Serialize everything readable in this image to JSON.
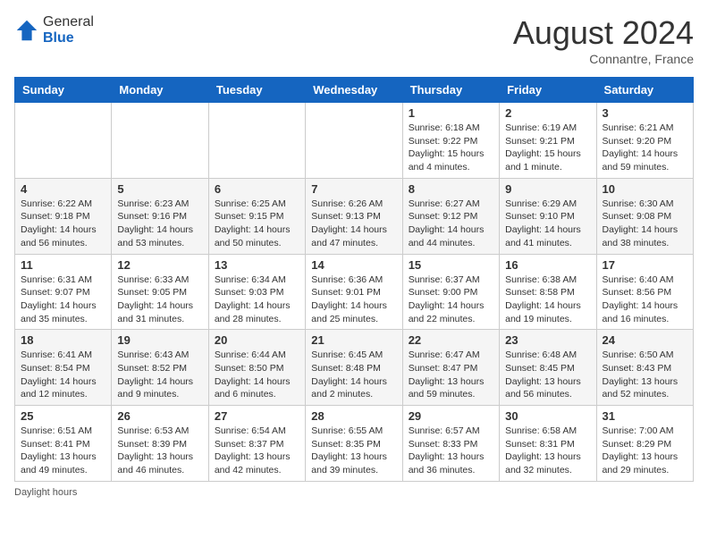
{
  "header": {
    "logo": {
      "line1": "General",
      "line2": "Blue"
    },
    "title": "August 2024",
    "location": "Connantre, France"
  },
  "days_of_week": [
    "Sunday",
    "Monday",
    "Tuesday",
    "Wednesday",
    "Thursday",
    "Friday",
    "Saturday"
  ],
  "weeks": [
    [
      {
        "day": "",
        "info": ""
      },
      {
        "day": "",
        "info": ""
      },
      {
        "day": "",
        "info": ""
      },
      {
        "day": "",
        "info": ""
      },
      {
        "day": "1",
        "info": "Sunrise: 6:18 AM\nSunset: 9:22 PM\nDaylight: 15 hours\nand 4 minutes."
      },
      {
        "day": "2",
        "info": "Sunrise: 6:19 AM\nSunset: 9:21 PM\nDaylight: 15 hours\nand 1 minute."
      },
      {
        "day": "3",
        "info": "Sunrise: 6:21 AM\nSunset: 9:20 PM\nDaylight: 14 hours\nand 59 minutes."
      }
    ],
    [
      {
        "day": "4",
        "info": "Sunrise: 6:22 AM\nSunset: 9:18 PM\nDaylight: 14 hours\nand 56 minutes."
      },
      {
        "day": "5",
        "info": "Sunrise: 6:23 AM\nSunset: 9:16 PM\nDaylight: 14 hours\nand 53 minutes."
      },
      {
        "day": "6",
        "info": "Sunrise: 6:25 AM\nSunset: 9:15 PM\nDaylight: 14 hours\nand 50 minutes."
      },
      {
        "day": "7",
        "info": "Sunrise: 6:26 AM\nSunset: 9:13 PM\nDaylight: 14 hours\nand 47 minutes."
      },
      {
        "day": "8",
        "info": "Sunrise: 6:27 AM\nSunset: 9:12 PM\nDaylight: 14 hours\nand 44 minutes."
      },
      {
        "day": "9",
        "info": "Sunrise: 6:29 AM\nSunset: 9:10 PM\nDaylight: 14 hours\nand 41 minutes."
      },
      {
        "day": "10",
        "info": "Sunrise: 6:30 AM\nSunset: 9:08 PM\nDaylight: 14 hours\nand 38 minutes."
      }
    ],
    [
      {
        "day": "11",
        "info": "Sunrise: 6:31 AM\nSunset: 9:07 PM\nDaylight: 14 hours\nand 35 minutes."
      },
      {
        "day": "12",
        "info": "Sunrise: 6:33 AM\nSunset: 9:05 PM\nDaylight: 14 hours\nand 31 minutes."
      },
      {
        "day": "13",
        "info": "Sunrise: 6:34 AM\nSunset: 9:03 PM\nDaylight: 14 hours\nand 28 minutes."
      },
      {
        "day": "14",
        "info": "Sunrise: 6:36 AM\nSunset: 9:01 PM\nDaylight: 14 hours\nand 25 minutes."
      },
      {
        "day": "15",
        "info": "Sunrise: 6:37 AM\nSunset: 9:00 PM\nDaylight: 14 hours\nand 22 minutes."
      },
      {
        "day": "16",
        "info": "Sunrise: 6:38 AM\nSunset: 8:58 PM\nDaylight: 14 hours\nand 19 minutes."
      },
      {
        "day": "17",
        "info": "Sunrise: 6:40 AM\nSunset: 8:56 PM\nDaylight: 14 hours\nand 16 minutes."
      }
    ],
    [
      {
        "day": "18",
        "info": "Sunrise: 6:41 AM\nSunset: 8:54 PM\nDaylight: 14 hours\nand 12 minutes."
      },
      {
        "day": "19",
        "info": "Sunrise: 6:43 AM\nSunset: 8:52 PM\nDaylight: 14 hours\nand 9 minutes."
      },
      {
        "day": "20",
        "info": "Sunrise: 6:44 AM\nSunset: 8:50 PM\nDaylight: 14 hours\nand 6 minutes."
      },
      {
        "day": "21",
        "info": "Sunrise: 6:45 AM\nSunset: 8:48 PM\nDaylight: 14 hours\nand 2 minutes."
      },
      {
        "day": "22",
        "info": "Sunrise: 6:47 AM\nSunset: 8:47 PM\nDaylight: 13 hours\nand 59 minutes."
      },
      {
        "day": "23",
        "info": "Sunrise: 6:48 AM\nSunset: 8:45 PM\nDaylight: 13 hours\nand 56 minutes."
      },
      {
        "day": "24",
        "info": "Sunrise: 6:50 AM\nSunset: 8:43 PM\nDaylight: 13 hours\nand 52 minutes."
      }
    ],
    [
      {
        "day": "25",
        "info": "Sunrise: 6:51 AM\nSunset: 8:41 PM\nDaylight: 13 hours\nand 49 minutes."
      },
      {
        "day": "26",
        "info": "Sunrise: 6:53 AM\nSunset: 8:39 PM\nDaylight: 13 hours\nand 46 minutes."
      },
      {
        "day": "27",
        "info": "Sunrise: 6:54 AM\nSunset: 8:37 PM\nDaylight: 13 hours\nand 42 minutes."
      },
      {
        "day": "28",
        "info": "Sunrise: 6:55 AM\nSunset: 8:35 PM\nDaylight: 13 hours\nand 39 minutes."
      },
      {
        "day": "29",
        "info": "Sunrise: 6:57 AM\nSunset: 8:33 PM\nDaylight: 13 hours\nand 36 minutes."
      },
      {
        "day": "30",
        "info": "Sunrise: 6:58 AM\nSunset: 8:31 PM\nDaylight: 13 hours\nand 32 minutes."
      },
      {
        "day": "31",
        "info": "Sunrise: 7:00 AM\nSunset: 8:29 PM\nDaylight: 13 hours\nand 29 minutes."
      }
    ]
  ],
  "footer": {
    "label": "Daylight hours"
  }
}
